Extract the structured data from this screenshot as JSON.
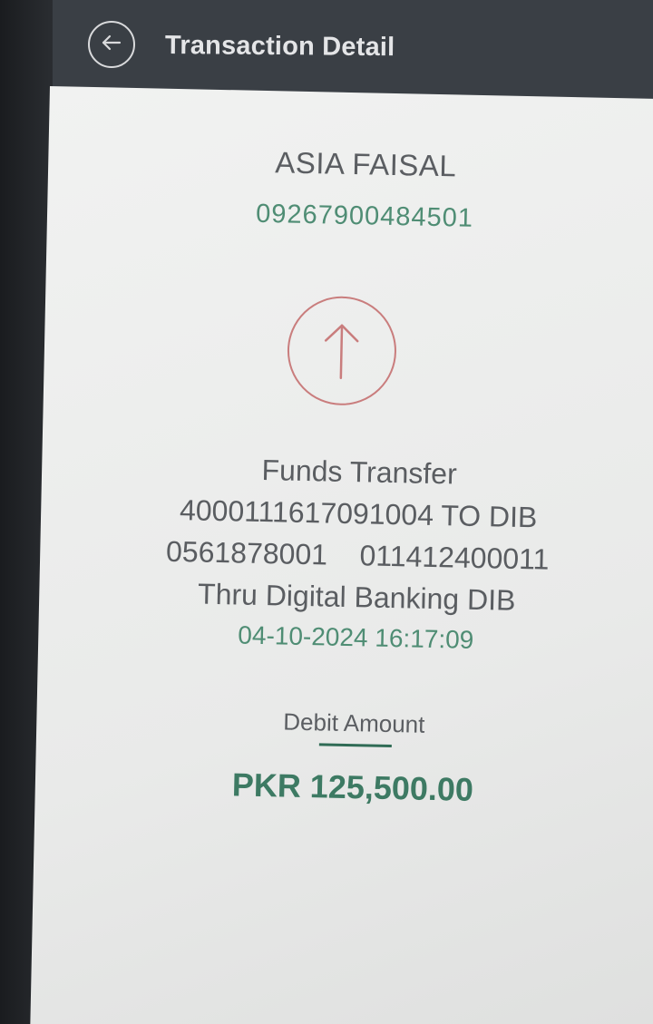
{
  "header": {
    "title": "Transaction Detail",
    "back_icon": "arrow-left-circle-icon"
  },
  "transaction": {
    "name": "ASIA FAISAL",
    "account_number": "09267900484501",
    "direction_icon": "arrow-up-circle-icon",
    "description_lines": [
      "Funds Transfer",
      "4000111617091004 TO DIB",
      "0561878001    011412400011",
      "Thru Digital Banking DIB"
    ],
    "datetime": "04-10-2024 16:17:09",
    "amount_label": "Debit Amount",
    "amount": "PKR 125,500.00"
  },
  "colors": {
    "accent_green": "#4f8d74",
    "arrow_red": "#c97d7d",
    "header_bg": "#3a3f45"
  }
}
